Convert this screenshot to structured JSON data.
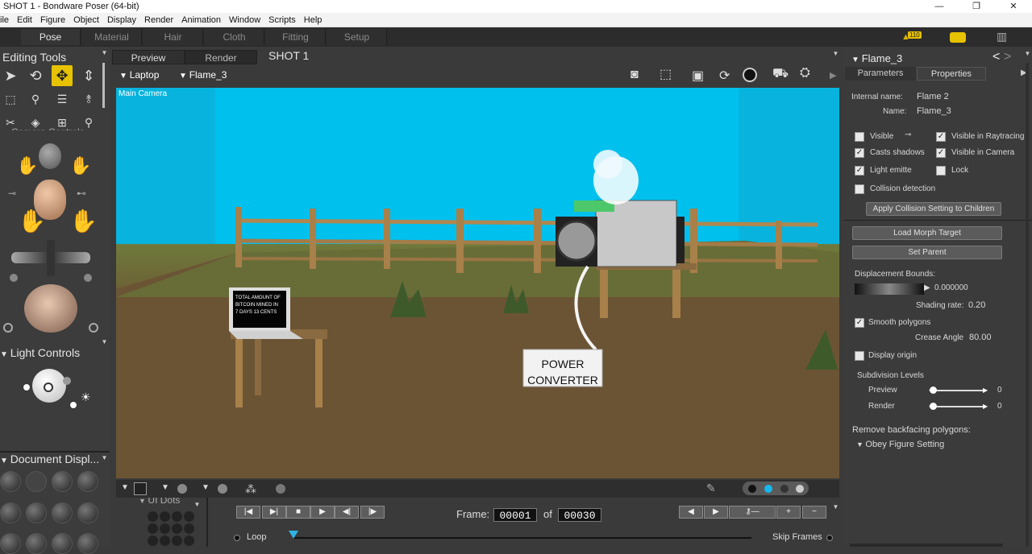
{
  "window": {
    "title": "SHOT 1 - Bondware Poser (64-bit)",
    "controls": [
      "—",
      "❐",
      "✕"
    ]
  },
  "menu": [
    "ile",
    "Edit",
    "Figure",
    "Object",
    "Display",
    "Render",
    "Animation",
    "Window",
    "Scripts",
    "Help"
  ],
  "rooms": [
    "Pose",
    "Material",
    "Hair",
    "Cloth",
    "Fitting",
    "Setup"
  ],
  "notifications": {
    "badge": "110"
  },
  "left": {
    "editing_tools": "Editing Tools",
    "camera_controls": "Camera Controls",
    "light_controls": "Light Controls",
    "document_display": "Document  Displ...",
    "ui_dots": "UI Dots"
  },
  "viewport": {
    "tabs": [
      "Preview",
      "Render"
    ],
    "doc_title": "SHOT 1",
    "figure_select": "Laptop",
    "actor_select": "Flame_3",
    "camera_label": "Main Camera",
    "laptop_screen": [
      "TOTAL AMOUNT OF",
      "BITCOIN MINED IN",
      "7 DAYS     13 CENTS"
    ],
    "box_label": [
      "POWER",
      "CONVERTER"
    ]
  },
  "playback": {
    "frame_label": "Frame:",
    "frame": "00001",
    "of_label": "of",
    "total": "00030",
    "loop": "Loop",
    "skip": "Skip Frames"
  },
  "right": {
    "title": "Flame_3",
    "tabs": [
      "Parameters",
      "Properties"
    ],
    "internal_name_label": "Internal name:",
    "internal_name": "Flame 2",
    "name_label": "Name:",
    "name": "Flame_3",
    "checks": {
      "visible": "Visible",
      "visible_raytracing": "Visible in Raytracing",
      "casts_shadows": "Casts shadows",
      "visible_camera": "Visible in Camera",
      "light_emitter": "Light emitte",
      "lock": "Lock",
      "collision": "Collision detection"
    },
    "apply_collision": "Apply Collision Setting to Children",
    "load_morph": "Load Morph Target",
    "set_parent": "Set Parent",
    "displacement_label": "Displacement Bounds:",
    "displacement_value": "0.000000",
    "shading_label": "Shading rate:",
    "shading_value": "0.20",
    "smooth": "Smooth polygons",
    "crease_label": "Crease Angle",
    "crease_value": "80.00",
    "display_origin": "Display origin",
    "subdiv_label": "Subdivision Levels",
    "preview_label": "Preview",
    "preview_value": "0",
    "render_label": "Render",
    "render_value": "0",
    "backface_label": "Remove backfacing polygons:",
    "backface_value": "Obey Figure Setting"
  },
  "colors": {
    "accent": "#e6c200",
    "sky": "#00c0ee"
  }
}
